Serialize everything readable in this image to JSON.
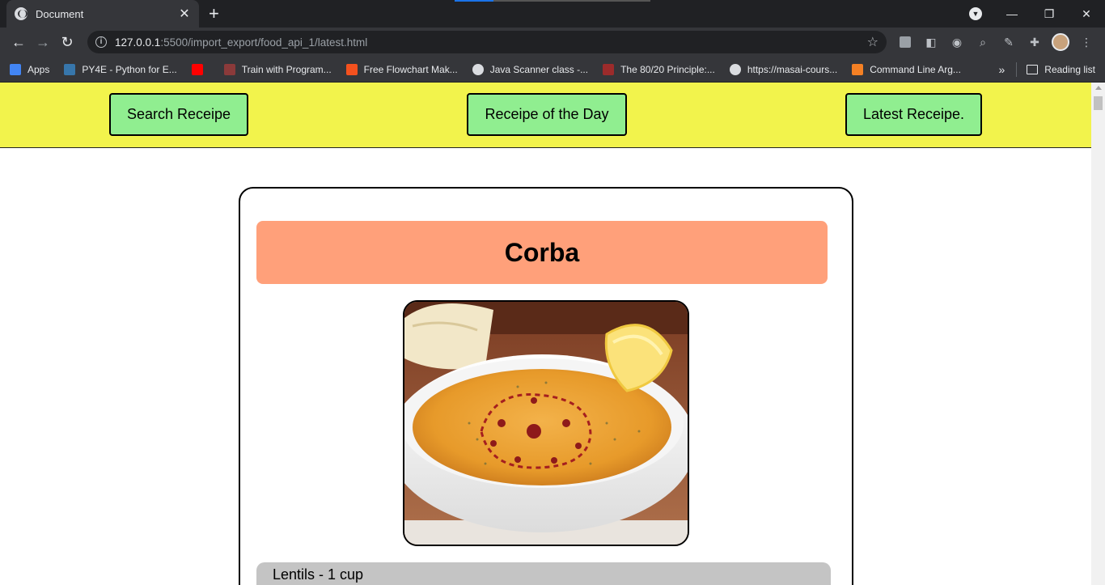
{
  "browser": {
    "tab_title": "Document",
    "url_host": "127.0.0.1",
    "url_rest": ":5500/import_export/food_api_1/latest.html",
    "bookmarks": [
      {
        "label": "Apps",
        "icon": "apps-grid-icon",
        "color": "#4285f4"
      },
      {
        "label": "PY4E - Python for E...",
        "icon": "python-icon",
        "color": "#3776ab"
      },
      {
        "label": "",
        "icon": "youtube-icon",
        "color": "#ff0000"
      },
      {
        "label": "Train with Program...",
        "icon": "program-icon",
        "color": "#8b3a3a"
      },
      {
        "label": "Free Flowchart Mak...",
        "icon": "flowchart-icon",
        "color": "#f4511e"
      },
      {
        "label": "Java Scanner class -...",
        "icon": "globe-icon",
        "color": "#dadce0"
      },
      {
        "label": "The 80/20 Principle:...",
        "icon": "pdf-icon",
        "color": "#9c2b2b"
      },
      {
        "label": "https://masai-cours...",
        "icon": "globe-icon",
        "color": "#dadce0"
      },
      {
        "label": "Command Line Arg...",
        "icon": "orange-logo-icon",
        "color": "#f48024"
      }
    ],
    "reading_list_label": "Reading list"
  },
  "nav": {
    "search_label": "Search Receipe",
    "day_label": "Receipe of the Day",
    "latest_label": "Latest Receipe."
  },
  "recipe": {
    "title": "Corba",
    "image_alt": "bowl of lentil soup with lemon and bread",
    "ingredient_first": "Lentils - 1 cup"
  },
  "colors": {
    "navbar_bg": "#f2f34c",
    "button_bg": "#90ee90",
    "title_bg": "#ffa07a",
    "ingredient_bg": "#c4c4c4"
  }
}
